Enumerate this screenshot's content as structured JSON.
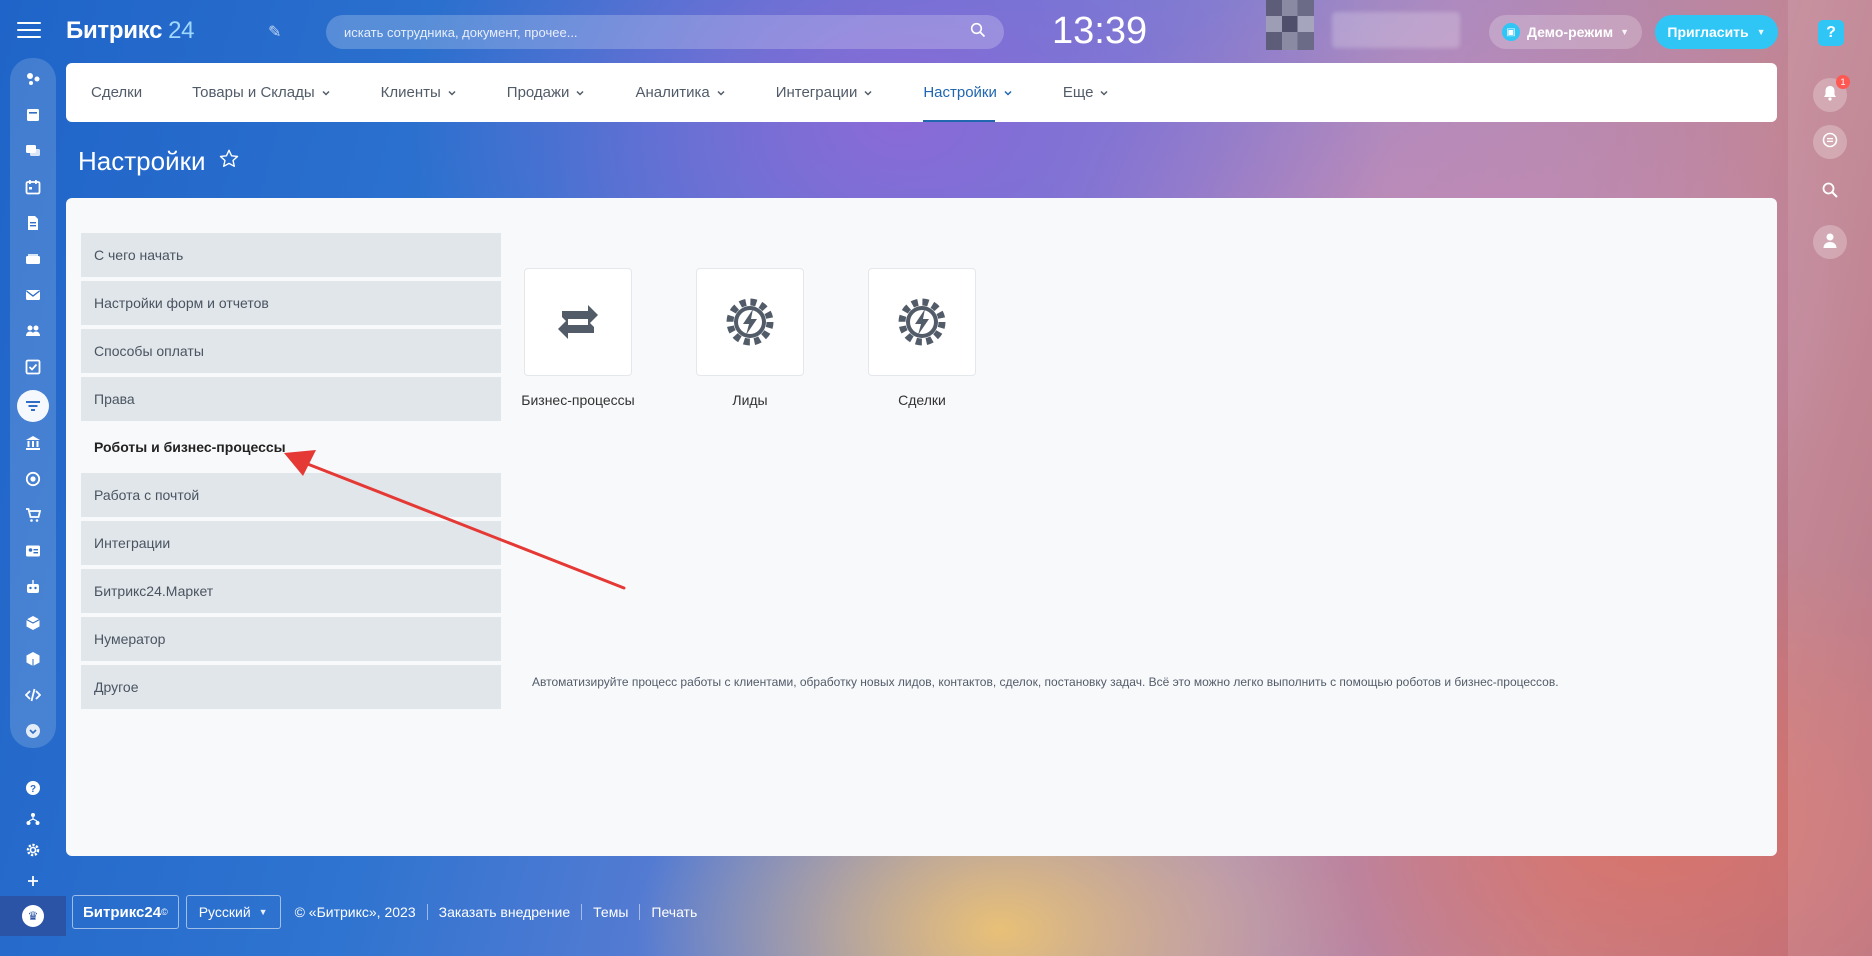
{
  "header": {
    "logo_main": "Битрикс",
    "logo_num": "24",
    "search_placeholder": "искать сотрудника, документ, прочее...",
    "clock": "13:39",
    "demo_label": "Демо-режим",
    "invite_label": "Пригласить"
  },
  "topnav": {
    "items": [
      {
        "label": "Сделки",
        "dropdown": false
      },
      {
        "label": "Товары и Склады",
        "dropdown": true
      },
      {
        "label": "Клиенты",
        "dropdown": true
      },
      {
        "label": "Продажи",
        "dropdown": true
      },
      {
        "label": "Аналитика",
        "dropdown": true
      },
      {
        "label": "Интеграции",
        "dropdown": true
      },
      {
        "label": "Настройки",
        "dropdown": true,
        "active": true
      },
      {
        "label": "Еще",
        "dropdown": true
      }
    ]
  },
  "page": {
    "title": "Настройки"
  },
  "side_menu": {
    "items": [
      {
        "label": "С чего начать"
      },
      {
        "label": "Настройки форм и отчетов"
      },
      {
        "label": "Способы оплаты"
      },
      {
        "label": "Права"
      },
      {
        "label": "Роботы и бизнес-процессы",
        "active": true
      },
      {
        "label": "Работа с почтой"
      },
      {
        "label": "Интеграции"
      },
      {
        "label": "Битрикс24.Маркет"
      },
      {
        "label": "Нумератор"
      },
      {
        "label": "Другое"
      }
    ]
  },
  "tiles": [
    {
      "label": "Бизнес-процессы",
      "icon": "refresh-arrows-icon"
    },
    {
      "label": "Лиды",
      "icon": "robot-gear-lightning-icon"
    },
    {
      "label": "Сделки",
      "icon": "robot-gear-lightning-icon"
    }
  ],
  "description": "Автоматизируйте процесс работы с клиентами, обработку новых лидов, контактов, сделок, постановку задач. Всё это можно легко выполнить с помощью роботов и бизнес-процессов.",
  "right_rail": {
    "notification_count": "1"
  },
  "footer": {
    "logo": "Битрикс24",
    "logo_mark": "©",
    "language": "Русский",
    "copyright": "© «Битрикс», 2023",
    "links": [
      "Заказать внедрение",
      "Темы",
      "Печать"
    ]
  },
  "colors": {
    "accent": "#2fc6f6",
    "nav_active": "#2067b0",
    "menu_bg": "#e1e6ea",
    "arrow": "#e53935"
  }
}
